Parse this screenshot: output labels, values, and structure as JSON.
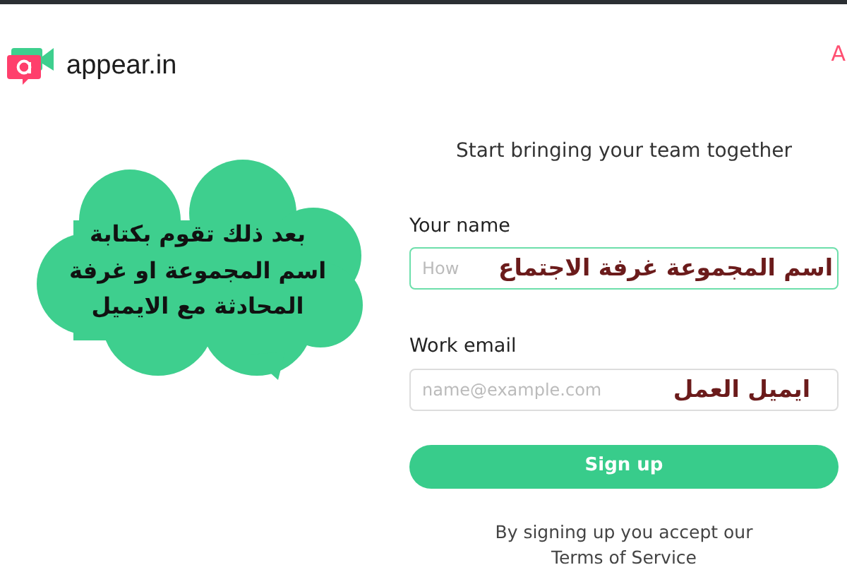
{
  "header": {
    "logo_text": "appear.in",
    "nav_link": "A"
  },
  "annotation_bubble": {
    "lines": [
      "بعد ذلك تقوم بكتابة",
      "اسم المجموعة او غرفة",
      "المحادثة مع الايميل"
    ]
  },
  "form": {
    "title": "Start bringing your team together",
    "fields": [
      {
        "label": "Your name",
        "placeholder": "How",
        "focused": true,
        "annotation": "اسم المجموعة غرفة الاجتماع"
      },
      {
        "label": "Work email",
        "placeholder": "name@example.com",
        "focused": false,
        "annotation": "ايميل العمل"
      }
    ],
    "submit": "Sign up",
    "terms_text": "By signing up you accept our",
    "terms_link": "Terms of Service"
  }
}
